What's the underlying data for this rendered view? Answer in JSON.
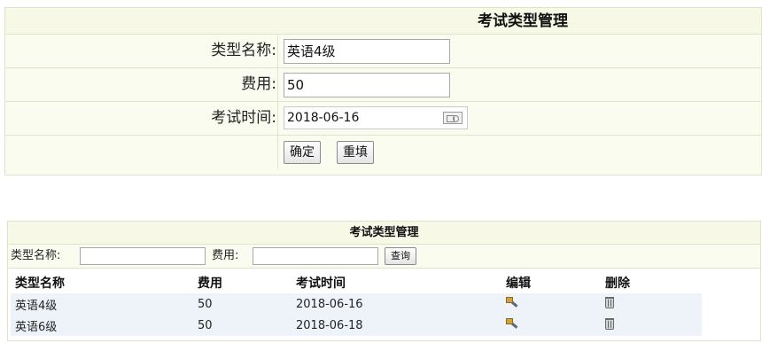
{
  "form": {
    "title": "考试类型管理",
    "name_label": "类型名称:",
    "name_value": "英语4级",
    "fee_label": "费用:",
    "fee_value": "50",
    "date_label": "考试时间:",
    "date_value": "2018-06-16",
    "confirm_label": "确定",
    "reset_label": "重填"
  },
  "list": {
    "title": "考试类型管理",
    "search_name_label": "类型名称:",
    "search_fee_label": "费用:",
    "search_button_label": "查询",
    "columns": [
      "类型名称",
      "费用",
      "考试时间",
      "编辑",
      "删除"
    ],
    "rows": [
      {
        "name": "英语4级",
        "fee": "50",
        "date": "2018-06-16",
        "edit_icon": "edit-icon",
        "delete_icon": "trash-icon"
      },
      {
        "name": "英语6级",
        "fee": "50",
        "date": "2018-06-18",
        "edit_icon": "edit-icon",
        "delete_icon": "trash-icon"
      }
    ]
  }
}
